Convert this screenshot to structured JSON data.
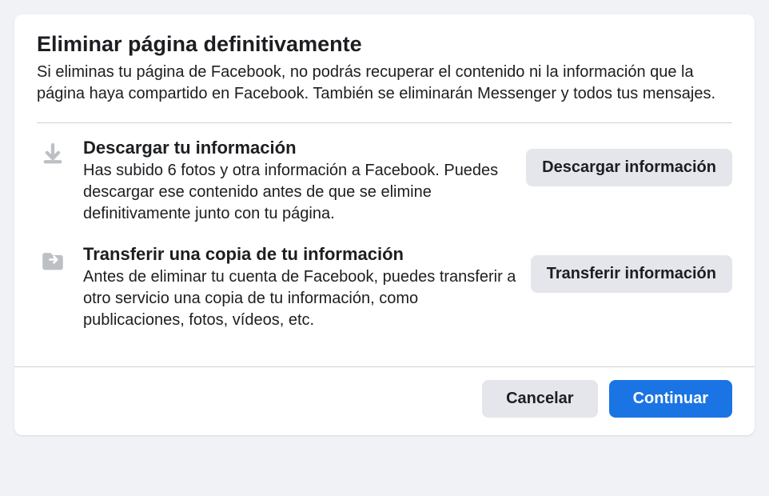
{
  "title": "Eliminar página definitivamente",
  "description": "Si eliminas tu página de Facebook, no podrás recuperar el contenido ni la información que la página haya compartido en Facebook. También se eliminarán Messenger y todos tus mensajes.",
  "download": {
    "title": "Descargar tu información",
    "desc": "Has subido 6 fotos y otra información a Facebook. Puedes descargar ese contenido antes de que se elimine definitivamente junto con tu página.",
    "button": "Descargar información"
  },
  "transfer": {
    "title": "Transferir una copia de tu información",
    "desc": "Antes de eliminar tu cuenta de Facebook, puedes transferir a otro servicio una copia de tu información, como publicaciones, fotos, vídeos, etc.",
    "button": "Transferir información"
  },
  "footer": {
    "cancel": "Cancelar",
    "continue": "Continuar"
  }
}
